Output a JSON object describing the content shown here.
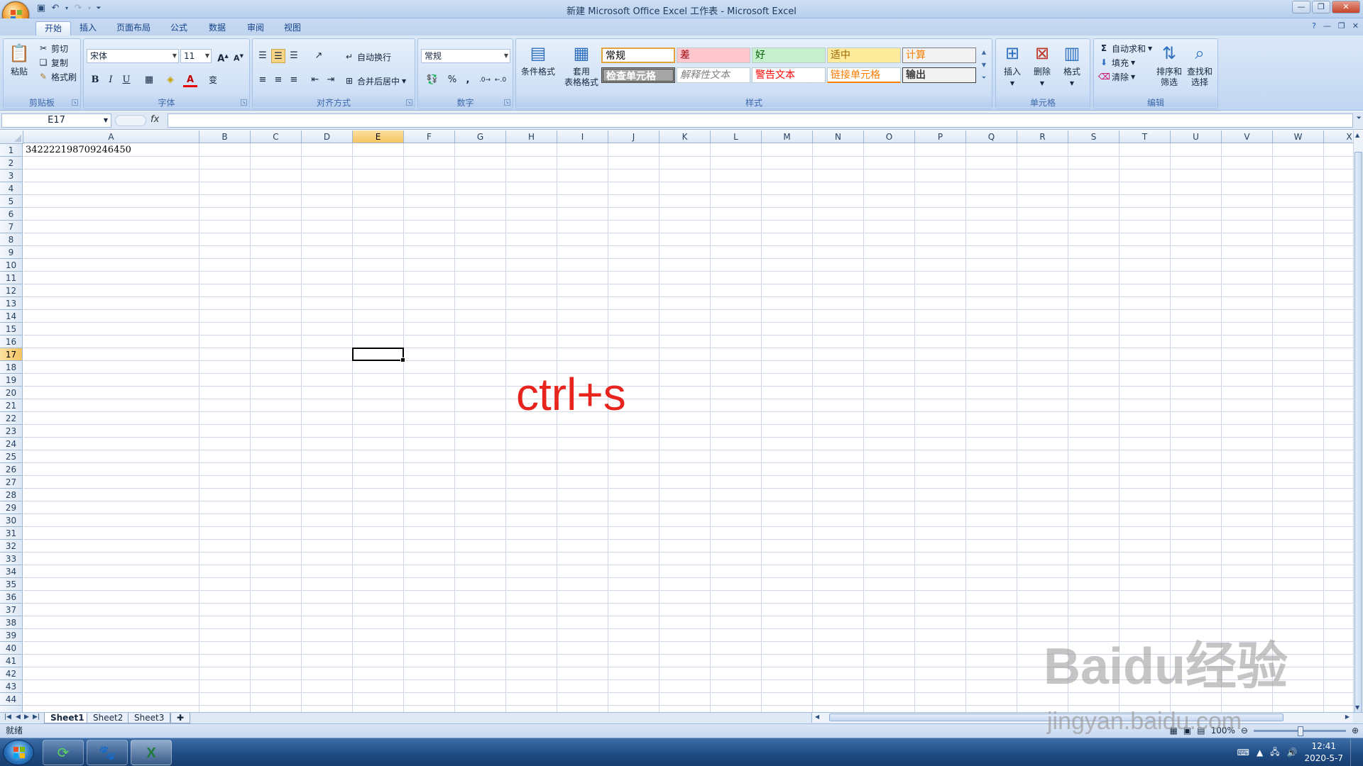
{
  "window": {
    "title": "新建 Microsoft Office Excel 工作表 - Microsoft Excel"
  },
  "ribbon_tabs": [
    "开始",
    "插入",
    "页面布局",
    "公式",
    "数据",
    "审阅",
    "视图"
  ],
  "clipboard": {
    "paste": "粘贴",
    "cut": "剪切",
    "copy": "复制",
    "format_painter": "格式刷",
    "label": "剪贴板"
  },
  "font": {
    "name": "宋体",
    "size": "11",
    "bold": "B",
    "italic": "I",
    "underline": "U",
    "grow": "A",
    "shrink": "A",
    "font_color": "A",
    "wen": "变",
    "label": "字体"
  },
  "alignment": {
    "wrap_text": "自动换行",
    "merge_center": "合并后居中",
    "label": "对齐方式"
  },
  "number": {
    "format": "常规",
    "percent": "%",
    "comma": ",",
    "label": "数字"
  },
  "styles": {
    "conditional": "条件格式",
    "table_line1": "套用",
    "table_line2": "表格格式",
    "cells": [
      {
        "text": "常规"
      },
      {
        "text": "差"
      },
      {
        "text": "好"
      },
      {
        "text": "适中"
      },
      {
        "text": "计算"
      },
      {
        "text": "检查单元格"
      },
      {
        "text": "解释性文本"
      },
      {
        "text": "警告文本"
      },
      {
        "text": "链接单元格"
      },
      {
        "text": "输出"
      }
    ],
    "label": "样式"
  },
  "cells_group": {
    "insert": "插入",
    "delete": "删除",
    "format": "格式",
    "label": "单元格"
  },
  "editing": {
    "autosum": "自动求和",
    "fill": "填充",
    "clear": "清除",
    "sort_line1": "排序和",
    "sort_line2": "筛选",
    "find_line1": "查找和",
    "find_line2": "选择",
    "label": "编辑"
  },
  "formula_bar": {
    "name_box": "E17",
    "fx": "fx"
  },
  "columns": [
    "A",
    "B",
    "C",
    "D",
    "E",
    "F",
    "G",
    "H",
    "I",
    "J",
    "K",
    "L",
    "M",
    "N",
    "O",
    "P",
    "Q",
    "R",
    "S",
    "T",
    "U",
    "V",
    "W",
    "X"
  ],
  "selected_column": "E",
  "selected_row": 17,
  "row_count": 44,
  "cell_A1": "342222198709246450",
  "annotation": "ctrl+s",
  "sheets": [
    "Sheet1",
    "Sheet2",
    "Sheet3"
  ],
  "status": {
    "ready": "就绪",
    "zoom": "100%"
  },
  "taskbar": {
    "time": "12:41",
    "date": "2020-5-7"
  },
  "watermark": {
    "line1": "Baidu经验",
    "line2": "jingyan.baidu.com"
  }
}
